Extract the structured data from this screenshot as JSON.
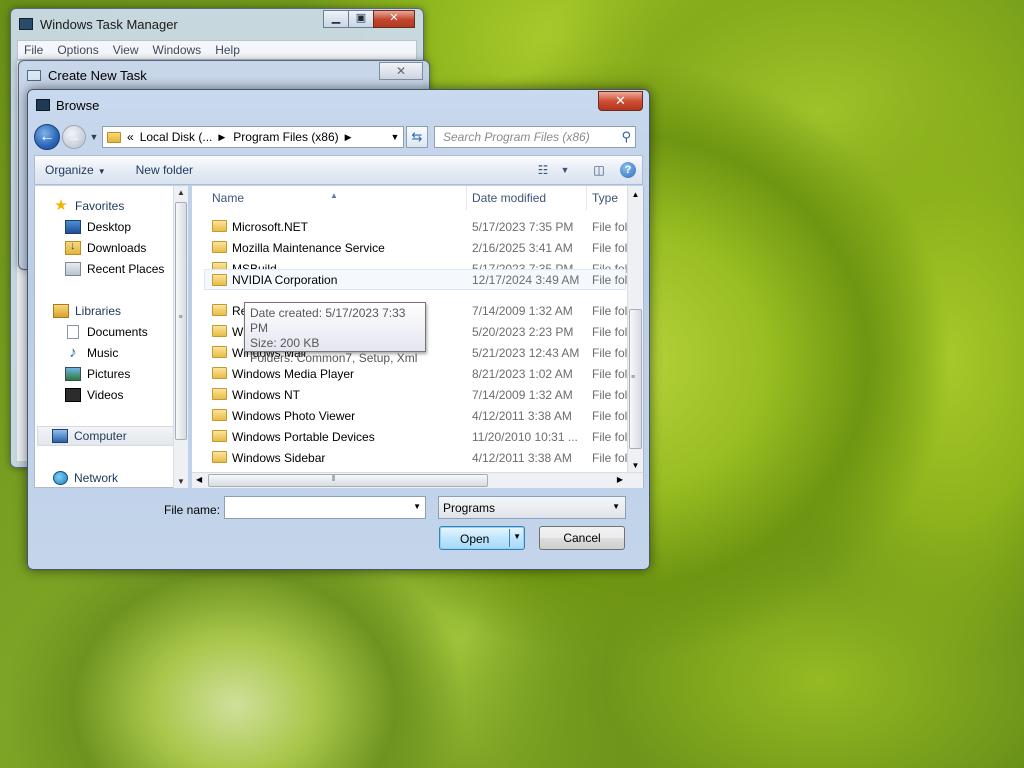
{
  "task_manager": {
    "title": "Windows Task Manager",
    "menu": [
      "File",
      "Options",
      "View",
      "Windows",
      "Help"
    ]
  },
  "create_new_task": {
    "title": "Create New Task"
  },
  "browse": {
    "title": "Browse",
    "address": {
      "prefix": "«",
      "segments": [
        "Local Disk (...",
        "Program Files (x86)"
      ]
    },
    "search_placeholder": "Search Program Files (x86)",
    "toolbar": {
      "organize": "Organize",
      "new_folder": "New folder"
    },
    "nav_pane": {
      "favorites": "Favorites",
      "desktop": "Desktop",
      "downloads": "Downloads",
      "recent_places": "Recent Places",
      "libraries": "Libraries",
      "documents": "Documents",
      "music": "Music",
      "pictures": "Pictures",
      "videos": "Videos",
      "computer": "Computer",
      "network": "Network"
    },
    "columns": {
      "name": "Name",
      "date_modified": "Date modified",
      "type": "Type"
    },
    "files": [
      {
        "name": "Microsoft.NET",
        "date": "5/17/2023 7:35 PM",
        "type": "File fol"
      },
      {
        "name": "Mozilla Maintenance Service",
        "date": "2/16/2025 3:41 AM",
        "type": "File fol"
      },
      {
        "name": "MSBuild",
        "date": "5/17/2023 7:35 PM",
        "type": "File fol"
      },
      {
        "name": "NVIDIA Corporation",
        "date": "12/17/2024 3:49 AM",
        "type": "File fol"
      },
      {
        "name": "Re",
        "date": "7/14/2009 1:32 AM",
        "type": "File fol"
      },
      {
        "name": "W",
        "date": "5/20/2023 2:23 PM",
        "type": "File fol"
      },
      {
        "name": "Windows Mail",
        "date": "5/21/2023 12:43 AM",
        "type": "File fol"
      },
      {
        "name": "Windows Media Player",
        "date": "8/21/2023 1:02 AM",
        "type": "File fol"
      },
      {
        "name": "Windows NT",
        "date": "7/14/2009 1:32 AM",
        "type": "File fol"
      },
      {
        "name": "Windows Photo Viewer",
        "date": "4/12/2011 3:38 AM",
        "type": "File fol"
      },
      {
        "name": "Windows Portable Devices",
        "date": "11/20/2010 10:31 ...",
        "type": "File fol"
      },
      {
        "name": "Windows Sidebar",
        "date": "4/12/2011 3:38 AM",
        "type": "File fol"
      }
    ],
    "tooltip": {
      "line1": "Date created: 5/17/2023 7:33 PM",
      "line2": "Size: 200 KB",
      "line3": "Folders: Common7, Setup, Xml"
    },
    "file_name_label": "File name:",
    "file_name_value": "",
    "file_type": "Programs",
    "open_label": "Open",
    "cancel_label": "Cancel"
  }
}
